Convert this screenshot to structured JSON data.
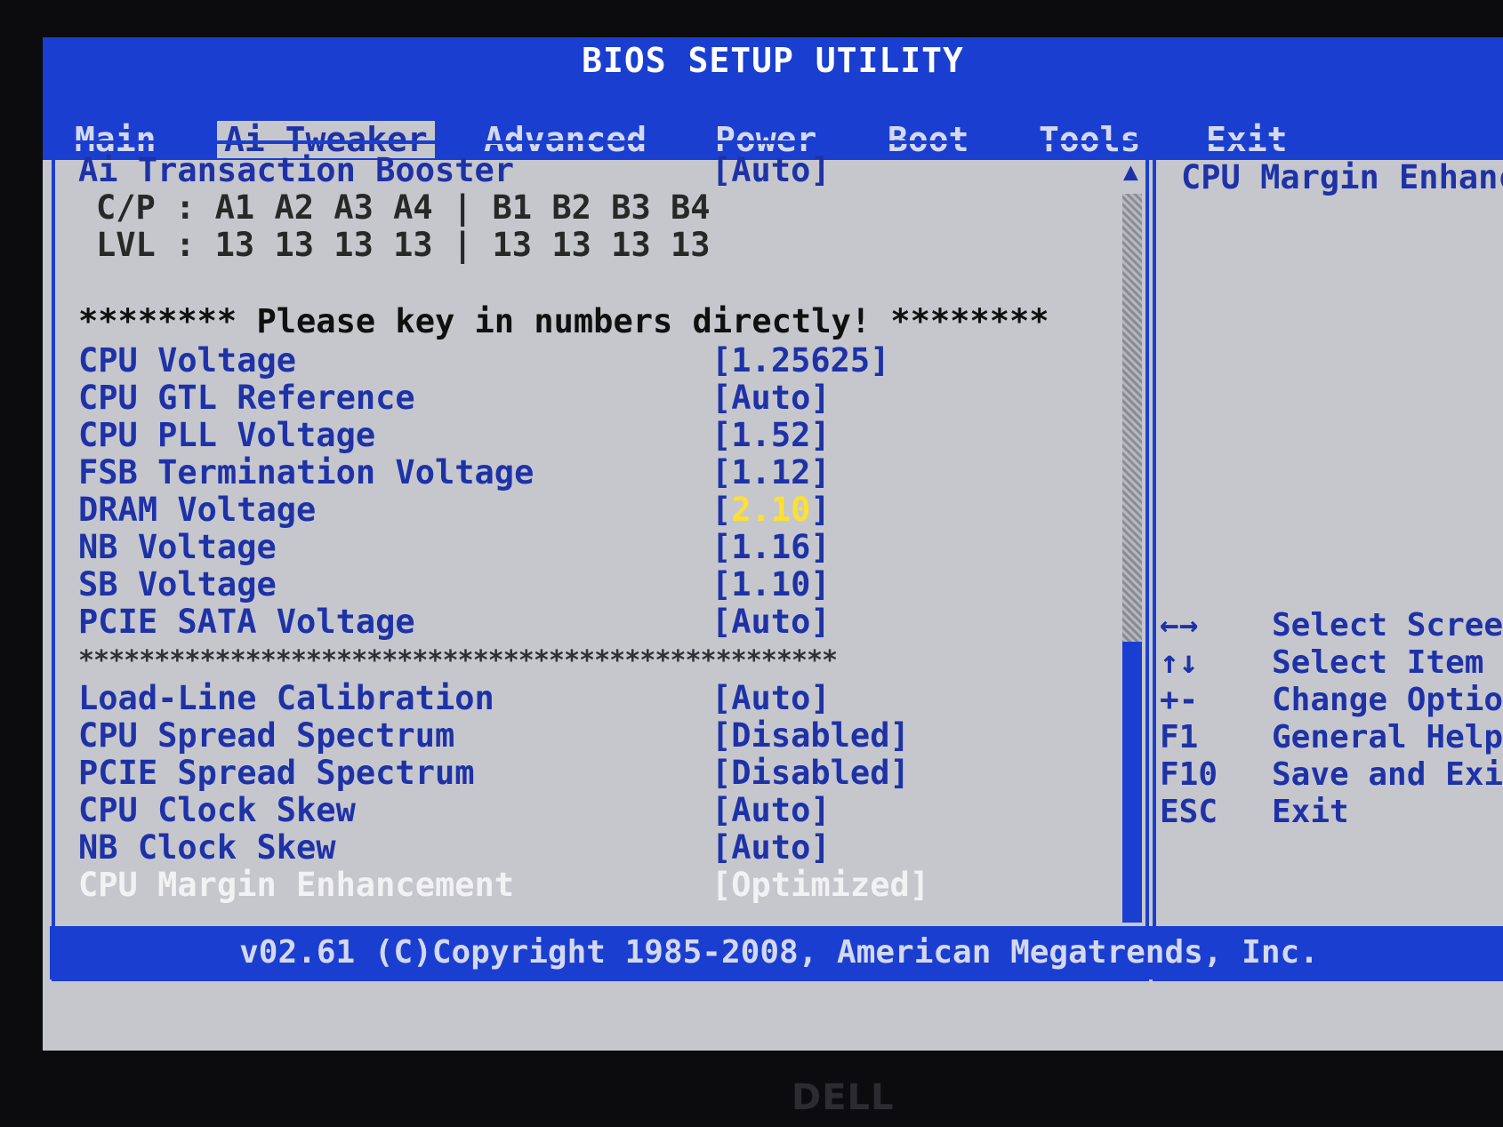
{
  "title": "BIOS SETUP UTILITY",
  "tabs": [
    {
      "label": "Main"
    },
    {
      "label": "Ai Tweaker"
    },
    {
      "label": "Advanced"
    },
    {
      "label": "Power"
    },
    {
      "label": "Boot"
    },
    {
      "label": "Tools"
    },
    {
      "label": "Exit"
    }
  ],
  "active_tab": "Ai Tweaker",
  "settings": {
    "ai_transaction_booster": {
      "label": "Ai Transaction Booster",
      "value": "[Auto]"
    },
    "cp_line": "C/P : A1 A2 A3 A4 | B1 B2 B3 B4",
    "lvl_line": "LVL : 13 13 13 13 | 13 13 13 13",
    "notice": "******** Please key in numbers directly! ********",
    "cpu_voltage": {
      "label": "CPU Voltage",
      "value": "[1.25625]"
    },
    "cpu_gtl_reference": {
      "label": "CPU GTL Reference",
      "value": "[Auto]"
    },
    "cpu_pll_voltage": {
      "label": "CPU PLL Voltage",
      "value": "[1.52]"
    },
    "fsb_termination_voltage": {
      "label": "FSB Termination Voltage",
      "value": "[1.12]"
    },
    "dram_voltage": {
      "label": "DRAM Voltage",
      "open": "[",
      "value": "2.10",
      "close": "]"
    },
    "nb_voltage": {
      "label": "NB Voltage",
      "value": "[1.16]"
    },
    "sb_voltage": {
      "label": "SB Voltage",
      "value": "[1.10]"
    },
    "pcie_sata_voltage": {
      "label": "PCIE SATA Voltage",
      "value": "[Auto]"
    },
    "separator": "**************************************************",
    "load_line_calibration": {
      "label": "Load-Line Calibration",
      "value": "[Auto]"
    },
    "cpu_spread_spectrum": {
      "label": "CPU Spread Spectrum",
      "value": "[Disabled]"
    },
    "pcie_spread_spectrum": {
      "label": "PCIE Spread Spectrum",
      "value": "[Disabled]"
    },
    "cpu_clock_skew": {
      "label": "CPU Clock Skew",
      "value": "[Auto]"
    },
    "nb_clock_skew": {
      "label": "NB Clock Skew",
      "value": "[Auto]"
    },
    "cpu_margin_enhancement": {
      "label": "CPU Margin Enhancement",
      "value": "[Optimized]"
    }
  },
  "help": {
    "title": "CPU Margin Enhanc",
    "keys": [
      {
        "key": "←→",
        "action": "Select Scree"
      },
      {
        "key": "↑↓",
        "action": "Select Item"
      },
      {
        "key": "+-",
        "action": "Change Optio"
      },
      {
        "key": "F1",
        "action": "General Help"
      },
      {
        "key": "F10",
        "action": "Save and Exi"
      },
      {
        "key": "ESC",
        "action": "Exit"
      }
    ]
  },
  "scroll": {
    "up_icon": "▲",
    "down_icon": "▼"
  },
  "footer": "v02.61 (C)Copyright 1985-2008, American Megatrends, Inc.",
  "bezel_brand": "DELL",
  "colors": {
    "accent_blue": "#1a3fd0",
    "panel_gray": "#c6c7cc",
    "text_blue": "#1e32a8",
    "highlight_yellow": "#ffe030",
    "selected_white": "#f2f2f4"
  }
}
